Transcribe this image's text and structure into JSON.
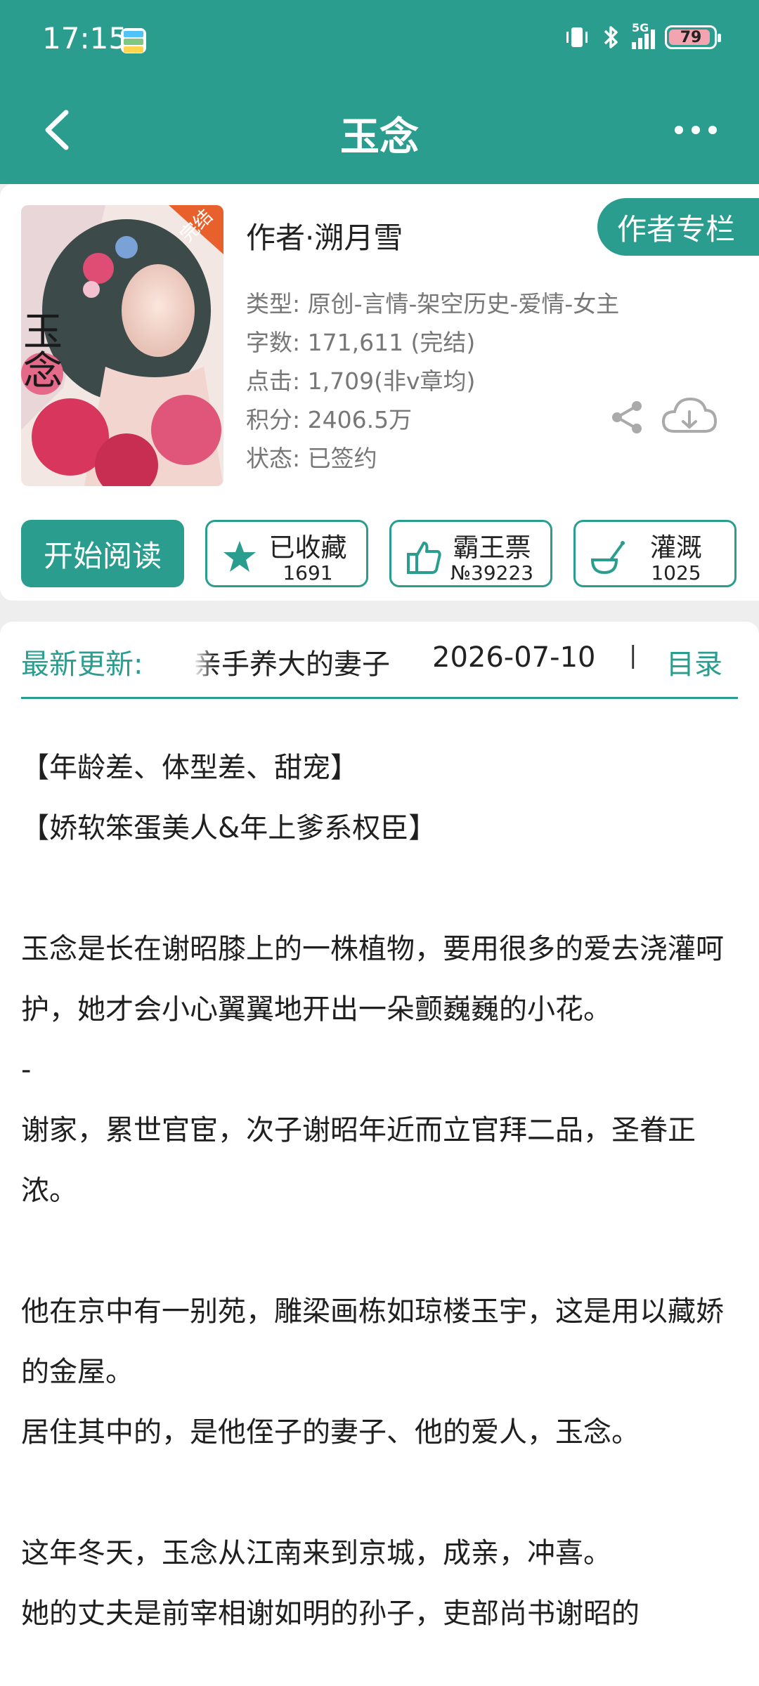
{
  "status_bar": {
    "time": "17:15",
    "network": "5G",
    "battery": "79"
  },
  "header": {
    "title": "玉念"
  },
  "book": {
    "cover_badge": "完结",
    "cover_title": "玉念",
    "author_line": "作者·溯月雪",
    "author_column_label": "作者专栏",
    "meta": {
      "type": "类型: 原创-言情-架空历史-爱情-女主",
      "words": "字数: 171,611 (完结)",
      "clicks": "点击: 1,709(非v章均)",
      "score": "积分: 2406.5万",
      "status": "状态: 已签约"
    }
  },
  "actions": {
    "read_label": "开始阅读",
    "favorite": {
      "label": "已收藏",
      "count": "1691"
    },
    "ticket": {
      "label": "霸王票",
      "count": "№39223"
    },
    "water": {
      "label": "灌溉",
      "count": "1025"
    }
  },
  "update": {
    "label": "最新更新:",
    "chapter": "亲手养大的妻子",
    "date": "2026-07-10",
    "separator": "|",
    "toc_label": "目录"
  },
  "intro": [
    "【年龄差、体型差、甜宠】",
    "【娇软笨蛋美人&年上爹系权臣】",
    "",
    "玉念是长在谢昭膝上的一株植物，要用很多的爱去浇灌呵护，她才会小心翼翼地开出一朵颤巍巍的小花。",
    "-",
    "谢家，累世官宦，次子谢昭年近而立官拜二品，圣眷正浓。",
    "",
    "他在京中有一别苑，雕梁画栋如琼楼玉宇，这是用以藏娇的金屋。",
    "居住其中的，是他侄子的妻子、他的爱人，玉念。",
    "",
    "这年冬天，玉念从江南来到京城，成亲，冲喜。",
    "她的丈夫是前宰相谢如明的孙子，吏部尚书谢昭的"
  ],
  "colors": {
    "accent": "#2a9d8f"
  }
}
